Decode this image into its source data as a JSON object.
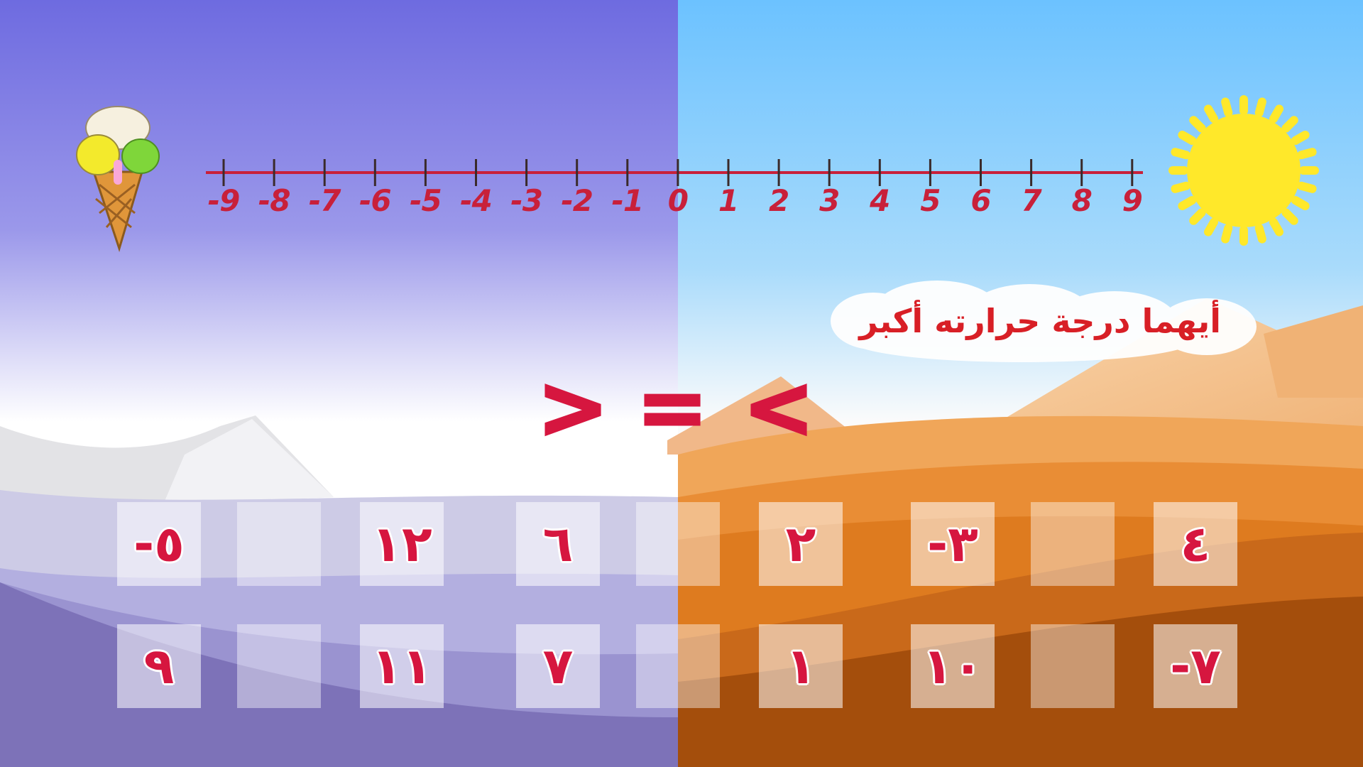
{
  "numberline": {
    "labels": [
      "-9",
      "-8",
      "-7",
      "-6",
      "-5",
      "-4",
      "-3",
      "-2",
      "-1",
      "0",
      "1",
      "2",
      "3",
      "4",
      "5",
      "6",
      "7",
      "8",
      "9"
    ]
  },
  "question": "أيهما درجة حرارته أكبر",
  "symbols": [
    ">",
    "=",
    "<"
  ],
  "tiles_row1": [
    "٥-",
    "",
    "١٢",
    "٦",
    "",
    "٢",
    "٣-",
    "",
    "٤"
  ],
  "tiles_row2": [
    "٩",
    "",
    "١١",
    "٧",
    "",
    "١",
    "١٠",
    "",
    "٧-"
  ],
  "colors": {
    "accent_red": "#d6163f",
    "numberline": "#c8203a",
    "sun": "#ffe82a",
    "cold_sky": "#6f6fe0",
    "hot_sky": "#6ec3ff",
    "desert": "#e07a1e"
  },
  "icons": [
    "ice-cream-icon",
    "sun-icon"
  ]
}
